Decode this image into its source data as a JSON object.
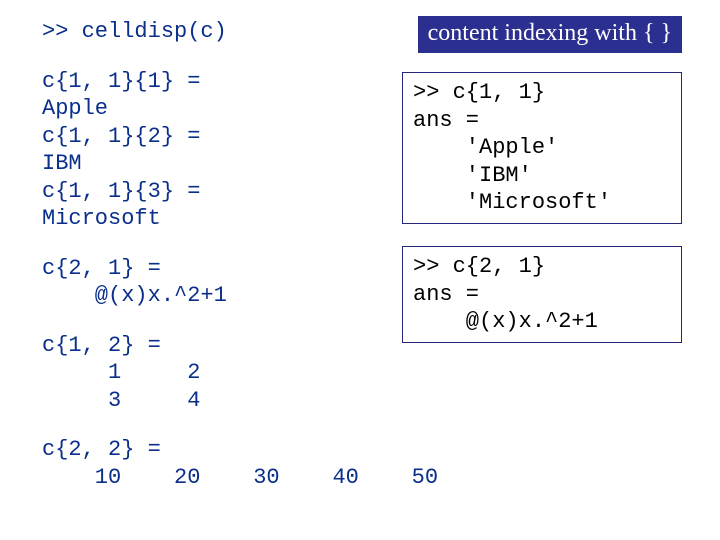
{
  "banner": "content indexing with { }",
  "left": {
    "cmd": ">> celldisp(c)",
    "cell11": "c{1, 1}{1} =\nApple\nc{1, 1}{2} =\nIBM\nc{1, 1}{3} =\nMicrosoft",
    "cell21": "c{2, 1} =\n    @(x)x.^2+1",
    "cell12": "c{1, 2} =\n     1     2\n     3     4",
    "cell22": "c{2, 2} =\n    10    20    30    40    50"
  },
  "box1": ">> c{1, 1}\nans =\n    'Apple'\n    'IBM'\n    'Microsoft'",
  "box2": ">> c{2, 1}\nans =\n    @(x)x.^2+1"
}
